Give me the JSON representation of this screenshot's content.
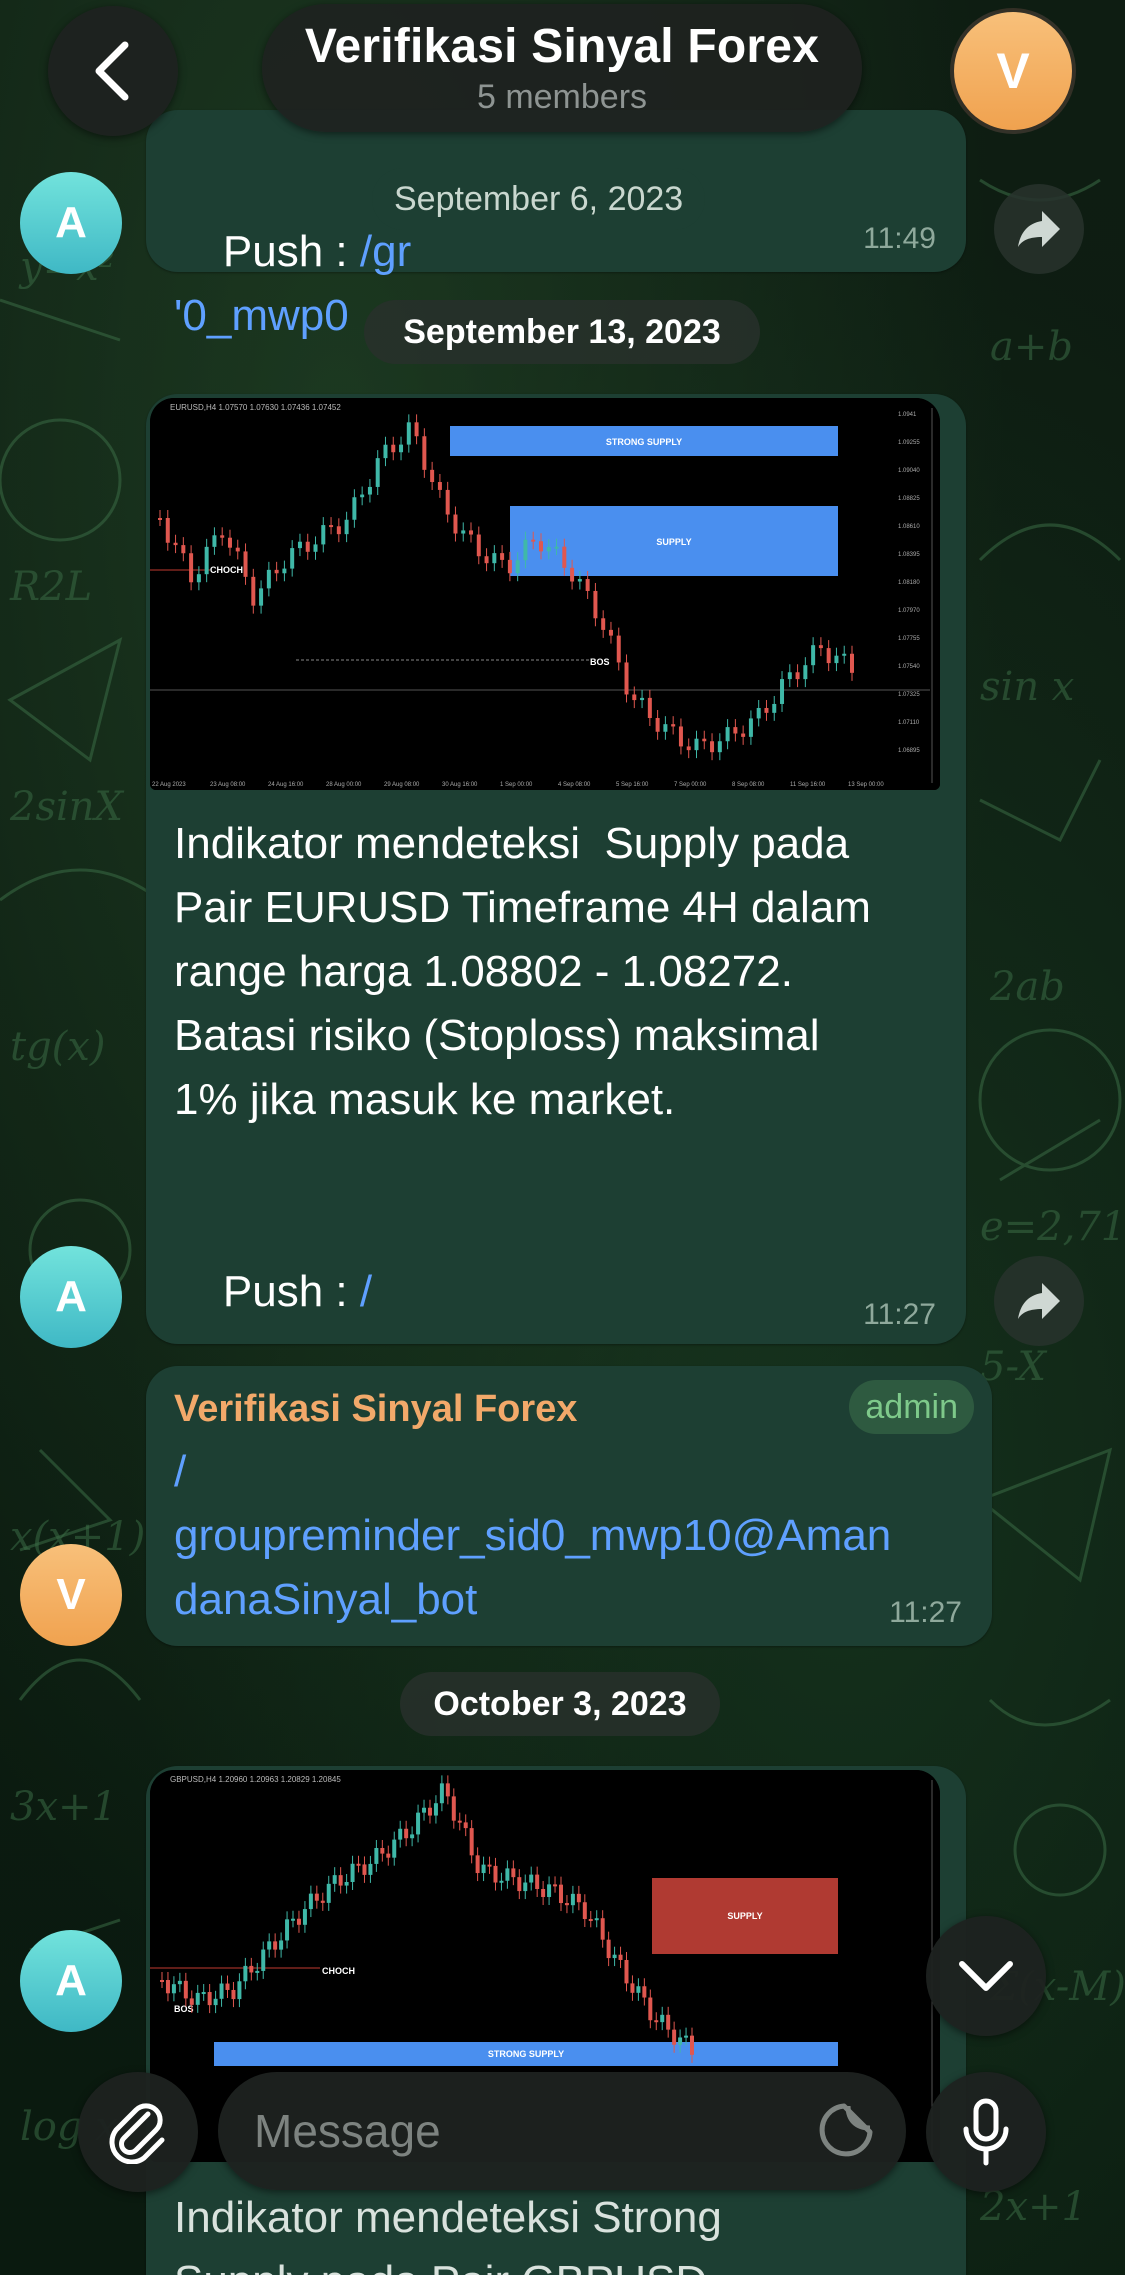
{
  "header": {
    "title": "Verifikasi Sinyal Forex",
    "subtitle": "5 members",
    "avatar_letter": "V"
  },
  "floating_date": "September 6, 2023",
  "messages": [
    {
      "avatar": "A",
      "text_prefix": "Push : ",
      "link_start": "/gr",
      "link_end": "'0_mwp0",
      "time": "11:49"
    },
    {
      "date": "September 13, 2023"
    },
    {
      "avatar": "A",
      "chart_title": "EURUSD,H4  1.07570 1.07630 1.07436 1.07452",
      "zones": [
        "STRONG SUPPLY",
        "SUPPLY"
      ],
      "markers": [
        "CHOCH",
        "BOS"
      ],
      "price_labels": [
        "1.0941",
        "1.09255",
        "1.09040",
        "1.08825",
        "1.08610",
        "1.08395",
        "1.08180",
        "1.07970",
        "1.07755",
        "1.07540",
        "1.07325",
        "1.07110",
        "1.06895"
      ],
      "time_labels": [
        "22 Aug 2023",
        "23 Aug 08:00",
        "24 Aug 16:00",
        "28 Aug 00:00",
        "29 Aug 08:00",
        "30 Aug 16:00",
        "1 Sep 00:00",
        "4 Sep 08:00",
        "5 Sep 16:00",
        "7 Sep 00:00",
        "8 Sep 08:00",
        "11 Sep 16:00",
        "13 Sep 00:00"
      ],
      "text": "Indikator mendeteksi  Supply pada\nPair EURUSD Timeframe 4H dalam\nrange harga 1.08802 - 1.08272.\nBatasi risiko (Stoploss) maksimal\n1% jika masuk ke market.",
      "push_label": "Push : ",
      "push_link_1": "/",
      "push_link_2": "groupreminder_sid0_mwp10",
      "time": "11:27"
    },
    {
      "avatar": "V",
      "sender": "Verifikasi Sinyal Forex",
      "role": "admin",
      "link_lines": [
        "/",
        "groupreminder_sid0_mwp10@Aman",
        "danaSinyal_bot"
      ],
      "time": "11:27"
    },
    {
      "date": "October 3, 2023"
    },
    {
      "avatar": "A",
      "chart_title": "GBPUSD,H4  1.20960 1.20963 1.20829 1.20845",
      "zones": [
        "SUPPLY",
        "STRONG SUPPLY"
      ],
      "markers": [
        "CHOCH",
        "BOS"
      ],
      "text_partial": "Indikator mendeteksi Strong",
      "text_partial_2": "Supply pada Pair GBPUSD"
    }
  ],
  "composer": {
    "placeholder": "Message"
  },
  "colors": {
    "bubble": "#1d3f33",
    "link": "#5fa0ff",
    "admin_name": "#f2a96a",
    "avatar_a": "#4fc6cf",
    "avatar_v": "#f4ae5f",
    "zone_blue": "#4a8fef",
    "zone_red": "#b03a32"
  }
}
